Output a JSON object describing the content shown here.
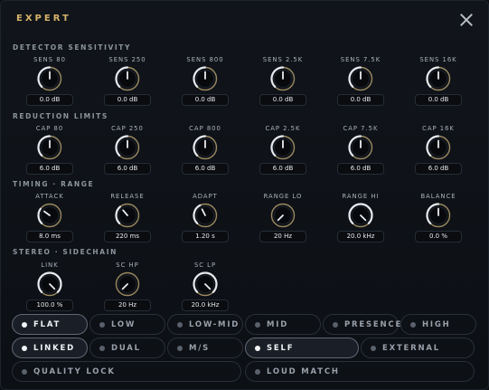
{
  "window": {
    "title": "EXPERT"
  },
  "icons": {
    "close": "close-icon",
    "knob": "knob-icon",
    "dot": "radio-dot-icon"
  },
  "colors": {
    "accent_title": "#d6b36a",
    "knob_ring": "#c9b27a",
    "active_pill_dot": "#f2f4f6"
  },
  "sections": {
    "detector": "DETECTOR SENSITIVITY",
    "reduction": "REDUCTION LIMITS",
    "timing": "TIMING · RANGE",
    "stereo": "STEREO · SIDECHAIN"
  },
  "detector": [
    {
      "label": "SENS 80",
      "value": "0.0 dB",
      "level": 0.5
    },
    {
      "label": "SENS 250",
      "value": "0.0 dB",
      "level": 0.5
    },
    {
      "label": "SENS 800",
      "value": "0.0 dB",
      "level": 0.5
    },
    {
      "label": "SENS 2.5K",
      "value": "0.0 dB",
      "level": 0.5
    },
    {
      "label": "SENS 7.5K",
      "value": "0.0 dB",
      "level": 0.5
    },
    {
      "label": "SENS 16K",
      "value": "0.0 dB",
      "level": 0.5
    }
  ],
  "reduction": [
    {
      "label": "CAP 80",
      "value": "6.0 dB",
      "level": 0.5
    },
    {
      "label": "CAP 250",
      "value": "6.0 dB",
      "level": 0.5
    },
    {
      "label": "CAP 800",
      "value": "6.0 dB",
      "level": 0.5
    },
    {
      "label": "CAP 2.5K",
      "value": "6.0 dB",
      "level": 0.5
    },
    {
      "label": "CAP 7.5K",
      "value": "6.0 dB",
      "level": 0.5
    },
    {
      "label": "CAP 16K",
      "value": "6.0 dB",
      "level": 0.5
    }
  ],
  "timing": [
    {
      "label": "ATTACK",
      "value": "8.0 ms",
      "level": 0.3
    },
    {
      "label": "RELEASE",
      "value": "220 ms",
      "level": 0.35
    },
    {
      "label": "ADAPT",
      "value": "1.20 s",
      "level": 0.4
    },
    {
      "label": "RANGE LO",
      "value": "20 Hz",
      "level": 0.0
    },
    {
      "label": "RANGE HI",
      "value": "20.0 kHz",
      "level": 1.0
    },
    {
      "label": "BALANCE",
      "value": "0.0 %",
      "level": 0.5
    }
  ],
  "stereo": [
    {
      "label": "LINK",
      "value": "100.0 %",
      "level": 1.0
    },
    {
      "label": "SC HP",
      "value": "20 Hz",
      "level": 0.0
    },
    {
      "label": "SC LP",
      "value": "20.0 kHz",
      "level": 1.0
    }
  ],
  "modes_row1": [
    {
      "label": "FLAT",
      "active": true
    },
    {
      "label": "LOW",
      "active": false
    },
    {
      "label": "LOW-MID",
      "active": false
    },
    {
      "label": "MID",
      "active": false
    },
    {
      "label": "PRESENCE",
      "active": false
    },
    {
      "label": "HIGH",
      "active": false
    }
  ],
  "modes_row2": [
    {
      "label": "LINKED",
      "active": true
    },
    {
      "label": "DUAL",
      "active": false
    },
    {
      "label": "M/S",
      "active": false
    },
    {
      "label": "SELF",
      "active": true
    },
    {
      "label": "EXTERNAL",
      "active": false
    }
  ],
  "modes_row3": [
    {
      "label": "QUALITY LOCK",
      "active": false
    },
    {
      "label": "LOUD MATCH",
      "active": false
    }
  ]
}
